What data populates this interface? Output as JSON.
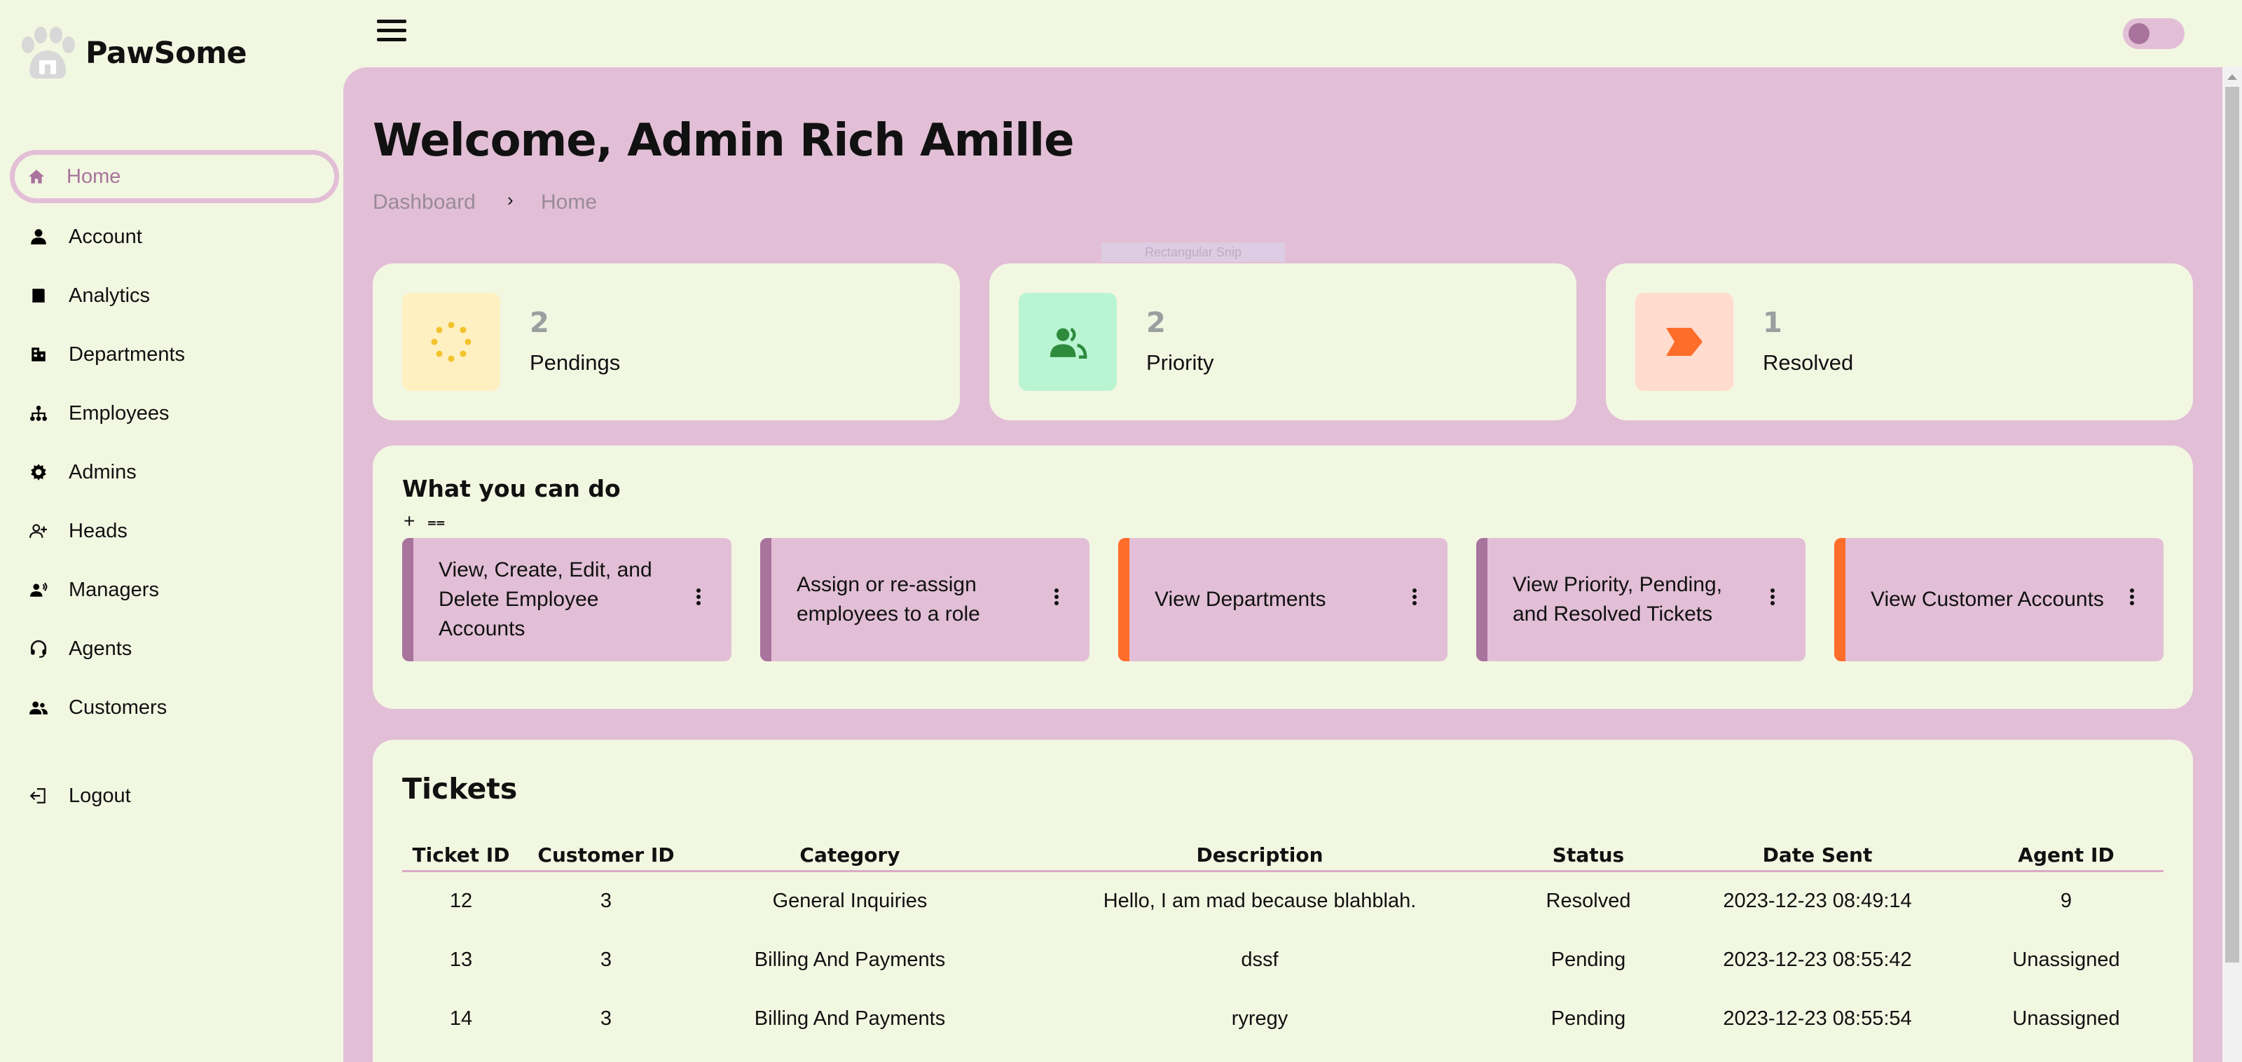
{
  "brand": {
    "name": "PawSome"
  },
  "sidebar": {
    "items": [
      {
        "label": "Home",
        "icon": "home-icon"
      },
      {
        "label": "Account",
        "icon": "person-icon"
      },
      {
        "label": "Analytics",
        "icon": "book-icon"
      },
      {
        "label": "Departments",
        "icon": "building-icon"
      },
      {
        "label": "Employees",
        "icon": "org-chart-icon"
      },
      {
        "label": "Admins",
        "icon": "gear-icon"
      },
      {
        "label": "Heads",
        "icon": "person-add-icon"
      },
      {
        "label": "Managers",
        "icon": "person-voice-icon"
      },
      {
        "label": "Agents",
        "icon": "headset-icon"
      },
      {
        "label": "Customers",
        "icon": "people-icon"
      },
      {
        "label": "Logout",
        "icon": "logout-icon"
      }
    ],
    "active": "Home"
  },
  "page": {
    "title": "Welcome, Admin Rich Amille",
    "breadcrumb": [
      "Dashboard",
      "Home"
    ],
    "breadcrumb_separator": "›",
    "snip_overlay": "Rectangular Snip"
  },
  "stats": [
    {
      "value": "2",
      "label": "Pendings",
      "icon": "spinner-icon",
      "bg": "#fff0c2",
      "fg": "#f3c32c"
    },
    {
      "value": "2",
      "label": "Priority",
      "icon": "people-icon",
      "bg": "#b9f5d3",
      "fg": "#2e8b3e"
    },
    {
      "value": "1",
      "label": "Resolved",
      "icon": "chevron-flag-icon",
      "bg": "#ffdccd",
      "fg": "#ff6d2a"
    }
  ],
  "actions": {
    "title": "What you can do",
    "tools": [
      "+",
      "⩵"
    ],
    "items": [
      {
        "label": "View, Create, Edit, and Delete Employee Accounts",
        "accent": "#a8739d"
      },
      {
        "label": "Assign or re-assign employees to a role",
        "accent": "#a8739d"
      },
      {
        "label": "View Departments",
        "accent": "#ff6d2a"
      },
      {
        "label": "View Priority, Pending, and Resolved Tickets",
        "accent": "#a8739d"
      },
      {
        "label": "View Customer Accounts",
        "accent": "#ff6d2a"
      }
    ]
  },
  "tickets": {
    "title": "Tickets",
    "columns": [
      "Ticket ID",
      "Customer ID",
      "Category",
      "Description",
      "Status",
      "Date Sent",
      "Agent ID"
    ],
    "rows": [
      [
        "12",
        "3",
        "General Inquiries",
        "Hello, I am mad because blahblah.",
        "Resolved",
        "2023-12-23 08:49:14",
        "9"
      ],
      [
        "13",
        "3",
        "Billing And Payments",
        "dssf",
        "Pending",
        "2023-12-23 08:55:42",
        "Unassigned"
      ],
      [
        "14",
        "3",
        "Billing And Payments",
        "ryregy",
        "Pending",
        "2023-12-23 08:55:54",
        "Unassigned"
      ]
    ]
  },
  "colors": {
    "background": "#f2f7e2",
    "panel": "#e2bfd6",
    "accent": "#a8739d",
    "orange": "#ff6d2a"
  }
}
